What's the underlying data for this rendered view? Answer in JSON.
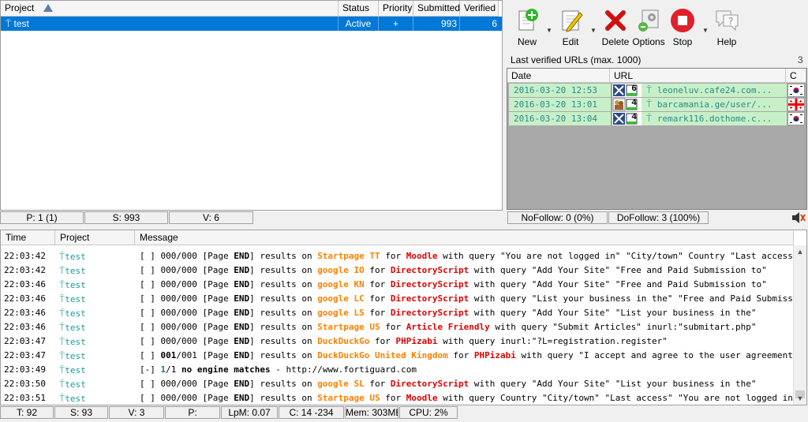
{
  "projects": {
    "columns": [
      "Project",
      "Status",
      "Priority",
      "Submitted",
      "Verified"
    ],
    "rows": [
      {
        "name": "test",
        "status": "Active",
        "priority": "+",
        "submitted": "993",
        "verified": "6"
      }
    ],
    "footer": {
      "p": "P: 1 (1)",
      "s": "S: 993",
      "v": "V: 6"
    }
  },
  "toolbar": {
    "new": "New",
    "edit": "Edit",
    "delete": "Delete",
    "options": "Options",
    "stop": "Stop",
    "help": "Help"
  },
  "urls": {
    "title": "Last verified URLs (max. 1000)",
    "count": "3",
    "columns": [
      "Date",
      "URL",
      "C"
    ],
    "rows": [
      {
        "date": "2016-03-20 12:53",
        "pr": "6",
        "url": "leoneluv.cafe24.com...",
        "flag": "kr"
      },
      {
        "date": "2016-03-20 13:01",
        "pr": "4",
        "url": "barcamania.ge/user/...",
        "flag": "ge"
      },
      {
        "date": "2016-03-20 13:04",
        "pr": "4",
        "url": "remark116.dothome.c...",
        "flag": "kr"
      }
    ],
    "footer": {
      "nofollow": "NoFollow: 0 (0%)",
      "dofollow": "DoFollow: 3 (100%)"
    }
  },
  "log": {
    "columns": [
      "Time",
      "Project",
      "Message"
    ],
    "rows": [
      {
        "time": "22:03:42",
        "project": "test",
        "parts": [
          [
            "n",
            "[ ] 000/000 [Page "
          ],
          [
            "b",
            "END"
          ],
          [
            "n",
            "] results on "
          ],
          [
            "or",
            "Startpage TT"
          ],
          [
            "n",
            " for "
          ],
          [
            "rd",
            "Moodle"
          ],
          [
            "n",
            " with query \"You are not logged in\" \"City/town\" Country \"Last access\""
          ]
        ]
      },
      {
        "time": "22:03:42",
        "project": "test",
        "parts": [
          [
            "n",
            "[ ] 000/000 [Page "
          ],
          [
            "b",
            "END"
          ],
          [
            "n",
            "] results on "
          ],
          [
            "or",
            "google IO"
          ],
          [
            "n",
            " for "
          ],
          [
            "rd",
            "DirectoryScript"
          ],
          [
            "n",
            " with query \"Add Your Site\" \"Free and Paid Submission to\""
          ]
        ]
      },
      {
        "time": "22:03:46",
        "project": "test",
        "parts": [
          [
            "n",
            "[ ] 000/000 [Page "
          ],
          [
            "b",
            "END"
          ],
          [
            "n",
            "] results on "
          ],
          [
            "or",
            "google KN"
          ],
          [
            "n",
            " for "
          ],
          [
            "rd",
            "DirectoryScript"
          ],
          [
            "n",
            " with query \"Add Your Site\" \"Free and Paid Submission to\""
          ]
        ]
      },
      {
        "time": "22:03:46",
        "project": "test",
        "parts": [
          [
            "n",
            "[ ] 000/000 [Page "
          ],
          [
            "b",
            "END"
          ],
          [
            "n",
            "] results on "
          ],
          [
            "or",
            "google LC"
          ],
          [
            "n",
            " for "
          ],
          [
            "rd",
            "DirectoryScript"
          ],
          [
            "n",
            " with query \"List your business in the\" \"Free and Paid Submission\""
          ]
        ]
      },
      {
        "time": "22:03:46",
        "project": "test",
        "parts": [
          [
            "n",
            "[ ] 000/000 [Page "
          ],
          [
            "b",
            "END"
          ],
          [
            "n",
            "] results on "
          ],
          [
            "or",
            "google LS"
          ],
          [
            "n",
            " for "
          ],
          [
            "rd",
            "DirectoryScript"
          ],
          [
            "n",
            " with query \"Add Your Site\" \"List your business in the\""
          ]
        ]
      },
      {
        "time": "22:03:46",
        "project": "test",
        "parts": [
          [
            "n",
            "[ ] 000/000 [Page "
          ],
          [
            "b",
            "END"
          ],
          [
            "n",
            "] results on "
          ],
          [
            "or",
            "Startpage US"
          ],
          [
            "n",
            " for "
          ],
          [
            "rd",
            "Article Friendly"
          ],
          [
            "n",
            " with query \"Submit Articles\" inurl:\"submitart.php\""
          ]
        ]
      },
      {
        "time": "22:03:47",
        "project": "test",
        "parts": [
          [
            "n",
            "[ ] 000/000 [Page "
          ],
          [
            "b",
            "END"
          ],
          [
            "n",
            "] results on "
          ],
          [
            "or",
            "DuckDuckGo"
          ],
          [
            "n",
            " for "
          ],
          [
            "rd",
            "PHPizabi"
          ],
          [
            "n",
            " with query inurl:\"?L=registration.register\""
          ]
        ]
      },
      {
        "time": "22:03:47",
        "project": "test",
        "parts": [
          [
            "n",
            "[ ] "
          ],
          [
            "b",
            "001"
          ],
          [
            "n",
            "/001 [Page "
          ],
          [
            "b",
            "END"
          ],
          [
            "n",
            "] results on "
          ],
          [
            "or",
            "DuckDuckGo United Kingdom"
          ],
          [
            "n",
            " for "
          ],
          [
            "rd",
            "PHPizabi"
          ],
          [
            "n",
            " with query \"I accept and agree to the user agreement\""
          ]
        ]
      },
      {
        "time": "22:03:49",
        "project": "test",
        "parts": [
          [
            "n",
            "[-] "
          ],
          [
            "tl",
            "1"
          ],
          [
            "n",
            "/1 "
          ],
          [
            "b",
            "no engine matches"
          ],
          [
            "n",
            " - http://www.fortiguard.com"
          ]
        ]
      },
      {
        "time": "22:03:50",
        "project": "test",
        "parts": [
          [
            "n",
            "[ ] 000/000 [Page "
          ],
          [
            "b",
            "END"
          ],
          [
            "n",
            "] results on "
          ],
          [
            "or",
            "google SL"
          ],
          [
            "n",
            " for "
          ],
          [
            "rd",
            "DirectoryScript"
          ],
          [
            "n",
            " with query \"Add Your Site\" \"List your business in the\""
          ]
        ]
      },
      {
        "time": "22:03:51",
        "project": "test",
        "parts": [
          [
            "n",
            "[ ] 000/000 [Page "
          ],
          [
            "b",
            "END"
          ],
          [
            "n",
            "] results on "
          ],
          [
            "or",
            "Startpage US"
          ],
          [
            "n",
            " for "
          ],
          [
            "rd",
            "Moodle"
          ],
          [
            "n",
            " with query Country \"City/town\" \"Last access\" \"You are not logged in\""
          ]
        ]
      }
    ]
  },
  "status": {
    "t": "T: 92",
    "s": "S: 93",
    "v": "V: 3",
    "p": "P:",
    "lpm": "LpM: 0.07",
    "c": "C: 14 -234",
    "mem": "Mem: 303MB",
    "cpu": "CPU: 2%"
  },
  "colors": {
    "selection": "#0078d7",
    "verified_bg": "#c8f0c8",
    "engine": "#ff8000",
    "platform": "#e00000"
  }
}
